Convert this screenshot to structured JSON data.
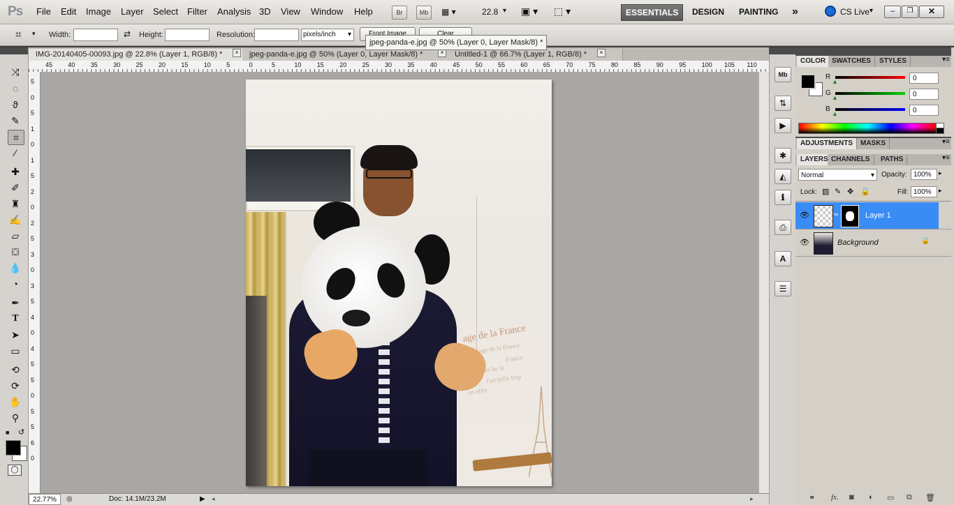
{
  "app": {
    "logo": "Ps"
  },
  "menus": [
    "File",
    "Edit",
    "Image",
    "Layer",
    "Select",
    "Filter",
    "Analysis",
    "3D",
    "View",
    "Window",
    "Help"
  ],
  "toolbar": {
    "br": "Br",
    "mb": "Mb",
    "zoom": "22.8"
  },
  "workspaces": [
    "ESSENTIALS",
    "DESIGN",
    "PAINTING"
  ],
  "workspace_more": "»",
  "cslive": "CS Live",
  "options": {
    "width_label": "Width:",
    "height_label": "Height:",
    "resolution_label": "Resolution:",
    "units": "pixels/inch",
    "front_image": "Front Image",
    "clear": "Clear"
  },
  "tooltip": "jpeg-panda-e.jpg @ 50% (Layer 0, Layer Mask/8) *",
  "tabs": [
    {
      "label": "IMG-20140405-00093.jpg @ 22.8% (Layer 1, RGB/8) *"
    },
    {
      "label": "jpeg-panda-e.jpg @ 50% (Layer 0, Layer Mask/8) *"
    },
    {
      "label": "Untitled-1 @ 66.7% (Layer 1, RGB/8) *"
    }
  ],
  "ruler_top": [
    "45",
    "40",
    "35",
    "30",
    "25",
    "20",
    "15",
    "10",
    "5",
    "0",
    "5",
    "10",
    "15",
    "20",
    "25",
    "30",
    "35",
    "40",
    "45",
    "50",
    "55",
    "60",
    "65",
    "70",
    "75",
    "80",
    "85",
    "90",
    "95",
    "100",
    "105",
    "110"
  ],
  "ruler_left": [
    "5",
    "0",
    "5",
    "1",
    "0",
    "1",
    "5",
    "2",
    "0",
    "2",
    "5",
    "3",
    "0",
    "3",
    "5",
    "4",
    "0",
    "4",
    "5",
    "5",
    "0",
    "5",
    "5",
    "6",
    "0"
  ],
  "status": {
    "zoom": "22.77%",
    "doc": "Doc: 14.1M/23.2M"
  },
  "photo": {
    "wall_text": [
      "age de la France",
      "sage de la France",
      "France",
      "ter lie la",
      "l'art belle lrop",
      "un effet"
    ]
  },
  "color_panel": {
    "tabs": [
      "COLOR",
      "SWATCHES",
      "STYLES"
    ],
    "channels": [
      {
        "name": "R",
        "value": "0"
      },
      {
        "name": "G",
        "value": "0"
      },
      {
        "name": "B",
        "value": "0"
      }
    ]
  },
  "adjust_panel": {
    "tabs": [
      "ADJUSTMENTS",
      "MASKS"
    ]
  },
  "layers_panel": {
    "tabs": [
      "LAYERS",
      "CHANNELS",
      "PATHS"
    ],
    "blend_mode": "Normal",
    "opacity_label": "Opacity:",
    "opacity": "100%",
    "lock_label": "Lock:",
    "fill_label": "Fill:",
    "fill": "100%",
    "layers": [
      {
        "name": "Layer 1",
        "selected": true
      },
      {
        "name": "Background",
        "selected": false
      }
    ]
  },
  "side_icons": [
    "Mb",
    "clone-source-icon",
    "play-icon",
    "star-icon",
    "histogram-icon",
    "info-icon",
    "stamp-icon",
    "character-icon",
    "paragraph-icon"
  ],
  "colors": {
    "accent": "#1e73ff",
    "selected_row": "#3a8cf5",
    "ps_tab_dark": "#5a5a5a"
  }
}
